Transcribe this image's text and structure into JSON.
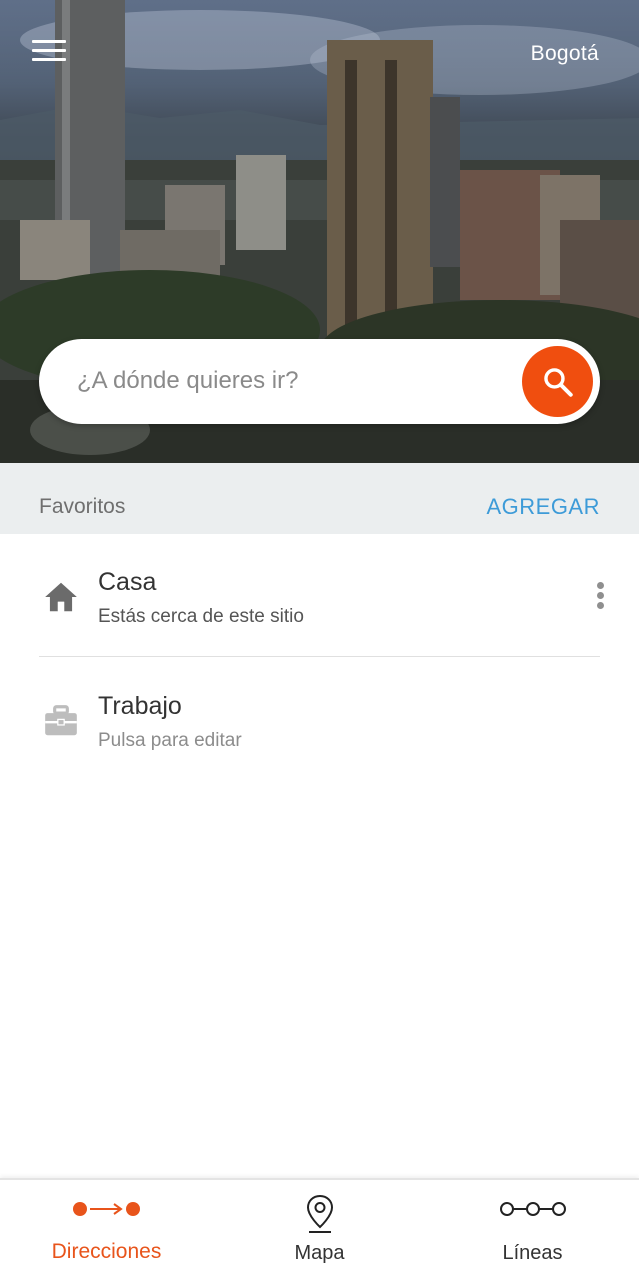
{
  "header": {
    "city": "Bogotá",
    "menu_icon": "hamburger-menu-icon"
  },
  "search": {
    "placeholder": "¿A dónde quieres ir?",
    "value": "",
    "icon": "search-icon",
    "accent_color": "#f04e0f"
  },
  "favorites": {
    "title": "Favoritos",
    "add_label": "AGREGAR",
    "items": [
      {
        "name": "Casa",
        "subtitle": "Estás cerca de este sitio",
        "icon": "home-icon"
      },
      {
        "name": "Trabajo",
        "subtitle": "Pulsa para editar",
        "icon": "briefcase-icon"
      }
    ]
  },
  "bottom_nav": {
    "items": [
      {
        "label": "Direcciones",
        "icon": "directions-icon",
        "active": true
      },
      {
        "label": "Mapa",
        "icon": "map-pin-icon",
        "active": false
      },
      {
        "label": "Líneas",
        "icon": "lines-icon",
        "active": false
      }
    ],
    "active_color": "#e8541b"
  }
}
